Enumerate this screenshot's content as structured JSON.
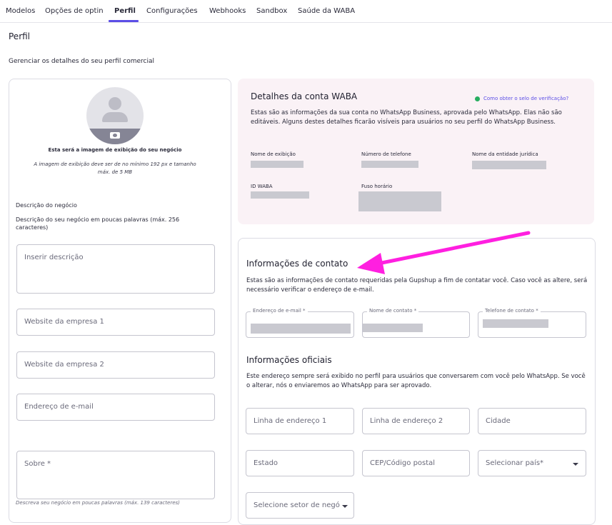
{
  "tabs": [
    {
      "label": "Modelos"
    },
    {
      "label": "Opções de optin"
    },
    {
      "label": "Perfil"
    },
    {
      "label": "Configurações"
    },
    {
      "label": "Webhooks"
    },
    {
      "label": "Sandbox"
    },
    {
      "label": "Saúde da WABA"
    }
  ],
  "page": {
    "title": "Perfil",
    "subtitle": "Gerenciar os detalhes do seu perfil comercial"
  },
  "profile": {
    "image_title": "Esta será a imagem de exibição do seu negócio",
    "image_hint": "A imagem de exibição deve ser de no mínimo 192 px e tamanho máx. de 5 MB",
    "description_label": "Descrição do negócio",
    "description_hint": "Descrição do seu negócio em poucas palavras (máx. 256 caracteres)",
    "description_placeholder": "Inserir descrição",
    "website1_placeholder": "Website da empresa 1",
    "website2_placeholder": "Website da empresa 2",
    "email_placeholder": "Endereço de e-mail",
    "about_placeholder": "Sobre *",
    "about_hint": "Descreva seu negócio em poucas palavras (máx. 139 caracteres)"
  },
  "waba": {
    "title": "Detalhes da conta WABA",
    "verify_link": "Como obter o selo de verificação?",
    "description": "Estas são as informações da sua conta no WhatsApp Business, aprovada pelo WhatsApp. Elas não são editáveis. Alguns destes detalhes ficarão visíveis para usuários no seu perfil do WhatsApp Business.",
    "display_name_label": "Nome de exibição",
    "phone_label": "Número de telefone",
    "legal_name_label": "Nome da entidade jurídica",
    "waba_id_label": "ID WABA",
    "timezone_label": "Fuso horário"
  },
  "contact": {
    "title": "Informações de contato",
    "description": "Estas são as informações de contato requeridas pela Gupshup a fim de contatar você. Caso você as altere, será necessário verificar o endereço de e-mail.",
    "email_label": "Endereço de e-mail *",
    "name_label": "Nome de contato *",
    "phone_label": "Telefone de contato *"
  },
  "official": {
    "title": "Informações oficiais",
    "description": "Este endereço sempre será exibido no perfil para usuários que conversarem com você pelo WhatsApp. Se você o alterar, nós o enviaremos ao WhatsApp para ser aprovado.",
    "address1": "Linha de endereço 1",
    "address2": "Linha de endereço 2",
    "city": "Cidade",
    "state": "Estado",
    "zip": "CEP/Código postal",
    "country": "Selecionar país*",
    "sector": "Selecione setor de negó"
  },
  "colors": {
    "accent": "#5b4ee6",
    "annotation_arrow": "#ff1fe0",
    "verified": "#27ae60"
  }
}
